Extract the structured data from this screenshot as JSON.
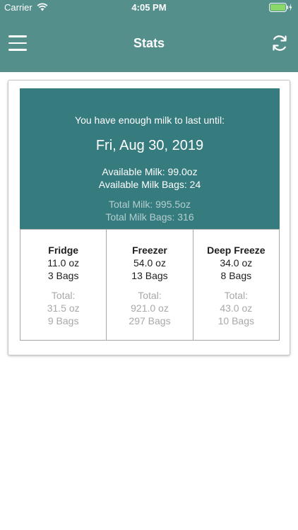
{
  "status_bar": {
    "carrier": "Carrier",
    "time": "4:05 PM",
    "battery_color": "#8bd86a"
  },
  "header": {
    "title": "Stats",
    "background": "#558f8c",
    "menu_icon": "hamburger-menu-icon",
    "refresh_icon": "refresh-icon"
  },
  "summary": {
    "enough_label": "You have enough milk to last until:",
    "until_date": "Fri, Aug 30, 2019",
    "available_milk": "Available Milk: 99.0oz",
    "available_bags": "Available Milk Bags: 24",
    "total_milk": "Total Milk: 995.5oz",
    "total_bags": "Total Milk Bags: 316",
    "background": "#367b7e"
  },
  "storage": [
    {
      "name": "Fridge",
      "oz": "11.0 oz",
      "bags": "3 Bags",
      "total_label": "Total:",
      "total_oz": "31.5 oz",
      "total_bags": "9 Bags"
    },
    {
      "name": "Freezer",
      "oz": "54.0 oz",
      "bags": "13 Bags",
      "total_label": "Total:",
      "total_oz": "921.0 oz",
      "total_bags": "297 Bags"
    },
    {
      "name": "Deep Freeze",
      "oz": "34.0 oz",
      "bags": "8 Bags",
      "total_label": "Total:",
      "total_oz": "43.0 oz",
      "total_bags": "10 Bags"
    }
  ]
}
